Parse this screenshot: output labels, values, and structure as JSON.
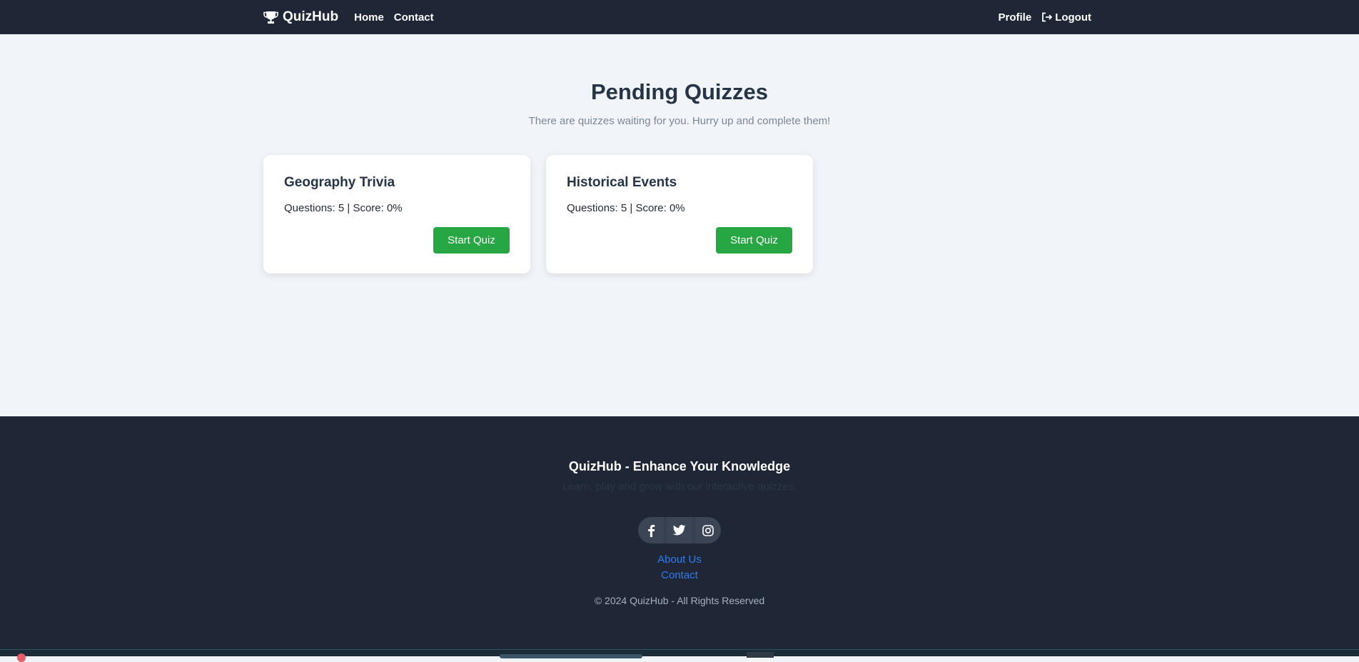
{
  "navbar": {
    "brand": "QuizHub",
    "brand_icon": "trophy-icon",
    "links": [
      "Home",
      "Contact"
    ],
    "profile": "Profile",
    "logout": "Logout",
    "logout_icon": "logout-icon"
  },
  "main": {
    "title": "Pending Quizzes",
    "subtitle": "There are quizzes waiting for you. Hurry up and complete them!",
    "quizzes": [
      {
        "title": "Geography Trivia",
        "meta": "Questions: 5 | Score: 0%",
        "button": "Start Quiz"
      },
      {
        "title": "Historical Events",
        "meta": "Questions: 5 | Score: 0%",
        "button": "Start Quiz"
      }
    ]
  },
  "footer": {
    "title": "QuizHub - Enhance Your Knowledge",
    "tagline": "Learn, play and grow with our interactive quizzes.",
    "socials": [
      "facebook-icon",
      "twitter-icon",
      "instagram-icon"
    ],
    "links": [
      "About Us",
      "Contact"
    ],
    "copyright": "© 2024 QuizHub - All Rights Reserved"
  },
  "colors": {
    "navbar_bg": "#1f2737",
    "page_bg": "#f1f4f9",
    "accent_green": "#27a744",
    "link_blue": "#2d7bf0"
  }
}
